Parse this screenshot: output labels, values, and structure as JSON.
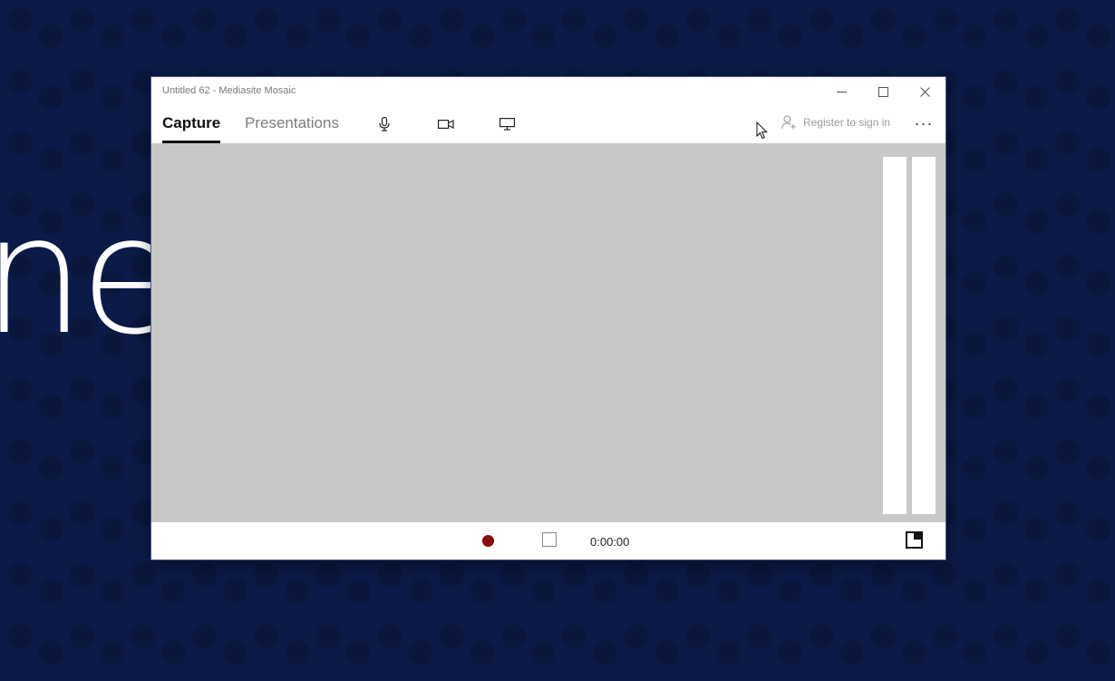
{
  "desktop": {
    "background_text": "ne",
    "background_color": "#0c1a47"
  },
  "window": {
    "title": "Untitled 62 - Mediasite Mosaic",
    "controls": {
      "minimize_icon": "minimize-icon",
      "maximize_icon": "maximize-icon",
      "close_icon": "close-icon"
    }
  },
  "nav": {
    "tabs": [
      {
        "label": "Capture",
        "active": true
      },
      {
        "label": "Presentations",
        "active": false
      }
    ],
    "source_icons": [
      "microphone-icon",
      "camera-icon",
      "monitor-icon"
    ],
    "register_label": "Register to sign in",
    "register_icon": "add-user-icon",
    "more_label": "···"
  },
  "preview": {
    "background_color": "#c8c9c6",
    "audio_meters": [
      "left",
      "right"
    ]
  },
  "bottom_bar": {
    "record_color": "#8b0a0a",
    "timer": "0:00:00",
    "pip_icon": "picture-in-picture-icon"
  }
}
